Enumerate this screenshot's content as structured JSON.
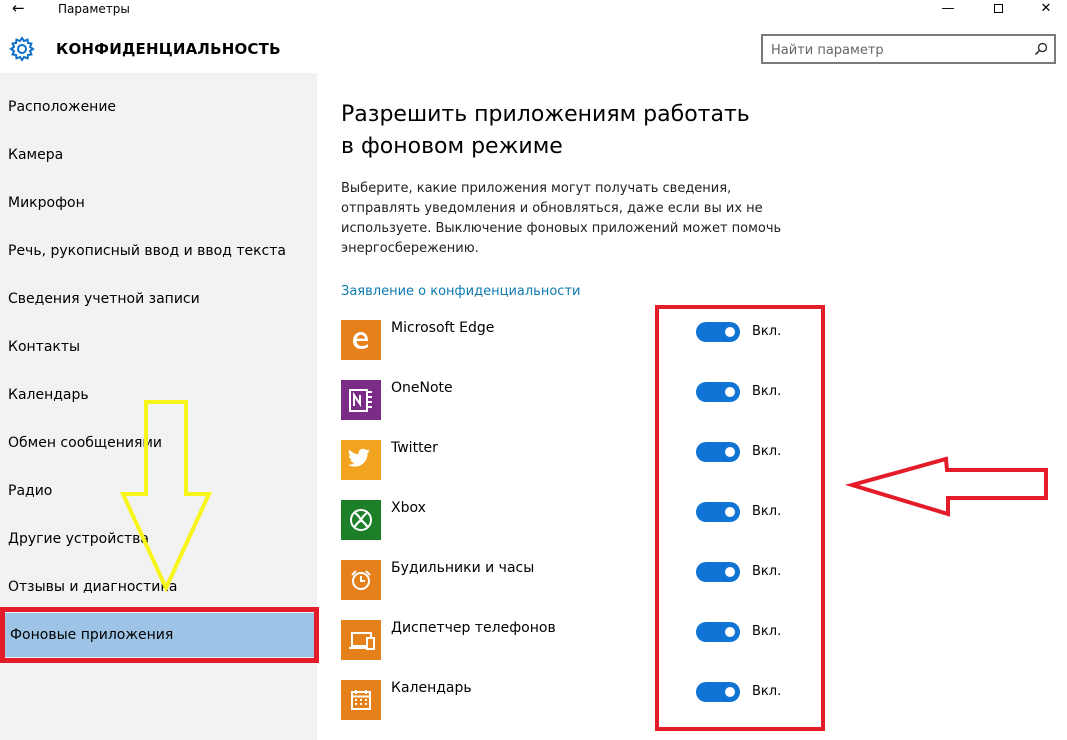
{
  "window": {
    "title": "Параметры",
    "back_glyph": "←",
    "minimize_glyph": "—",
    "close_glyph": "✕"
  },
  "header": {
    "title": "КОНФИДЕНЦИАЛЬНОСТЬ",
    "search_placeholder": "Найти параметр",
    "search_icon": "search-icon",
    "settings_icon": "gear-icon"
  },
  "sidebar": {
    "items": [
      {
        "label": "Расположение"
      },
      {
        "label": "Камера"
      },
      {
        "label": "Микрофон"
      },
      {
        "label": "Речь, рукописный ввод и ввод текста"
      },
      {
        "label": "Сведения учетной записи"
      },
      {
        "label": "Контакты"
      },
      {
        "label": "Календарь"
      },
      {
        "label": "Обмен сообщениями"
      },
      {
        "label": "Радио"
      },
      {
        "label": "Другие устройства"
      },
      {
        "label": "Отзывы и диагностика"
      },
      {
        "label": "Фоновые приложения",
        "selected": true
      }
    ]
  },
  "main": {
    "heading": "Разрешить приложениям работать в фоновом режиме",
    "description": "Выберите, какие приложения могут получать сведения, отправлять уведомления и обновляться, даже если вы их не используете. Выключение фоновых приложений может помочь энергосбережению.",
    "privacy_link": "Заявление о конфиденциальности",
    "apps": [
      {
        "name": "Microsoft Edge",
        "icon": "edge-icon",
        "tile_color": "#e6801a",
        "toggle_on": true,
        "toggle_label": "Вкл."
      },
      {
        "name": "OneNote",
        "icon": "onenote-icon",
        "tile_color": "#7b2c87",
        "toggle_on": true,
        "toggle_label": "Вкл."
      },
      {
        "name": "Twitter",
        "icon": "twitter-icon",
        "tile_color": "#f2a31f",
        "toggle_on": true,
        "toggle_label": "Вкл."
      },
      {
        "name": "Xbox",
        "icon": "xbox-icon",
        "tile_color": "#1d7f28",
        "toggle_on": true,
        "toggle_label": "Вкл."
      },
      {
        "name": "Будильники и часы",
        "icon": "alarm-clock-icon",
        "tile_color": "#e6801a",
        "toggle_on": true,
        "toggle_label": "Вкл."
      },
      {
        "name": "Диспетчер телефонов",
        "icon": "phone-companion-icon",
        "tile_color": "#e6801a",
        "toggle_on": true,
        "toggle_label": "Вкл."
      },
      {
        "name": "Календарь",
        "icon": "calendar-icon",
        "tile_color": "#e6801a",
        "toggle_on": true,
        "toggle_label": "Вкл."
      }
    ]
  },
  "annotations": {
    "highlight_color": "#e41c2a",
    "arrow_yellow": "#f7f51a",
    "arrow_red": "#e41c2a"
  },
  "colors": {
    "accent": "#0f74d3",
    "sidebar_bg": "#f2f2f2",
    "selected_bg": "#9dc4e6",
    "link": "#0f7ab0"
  }
}
